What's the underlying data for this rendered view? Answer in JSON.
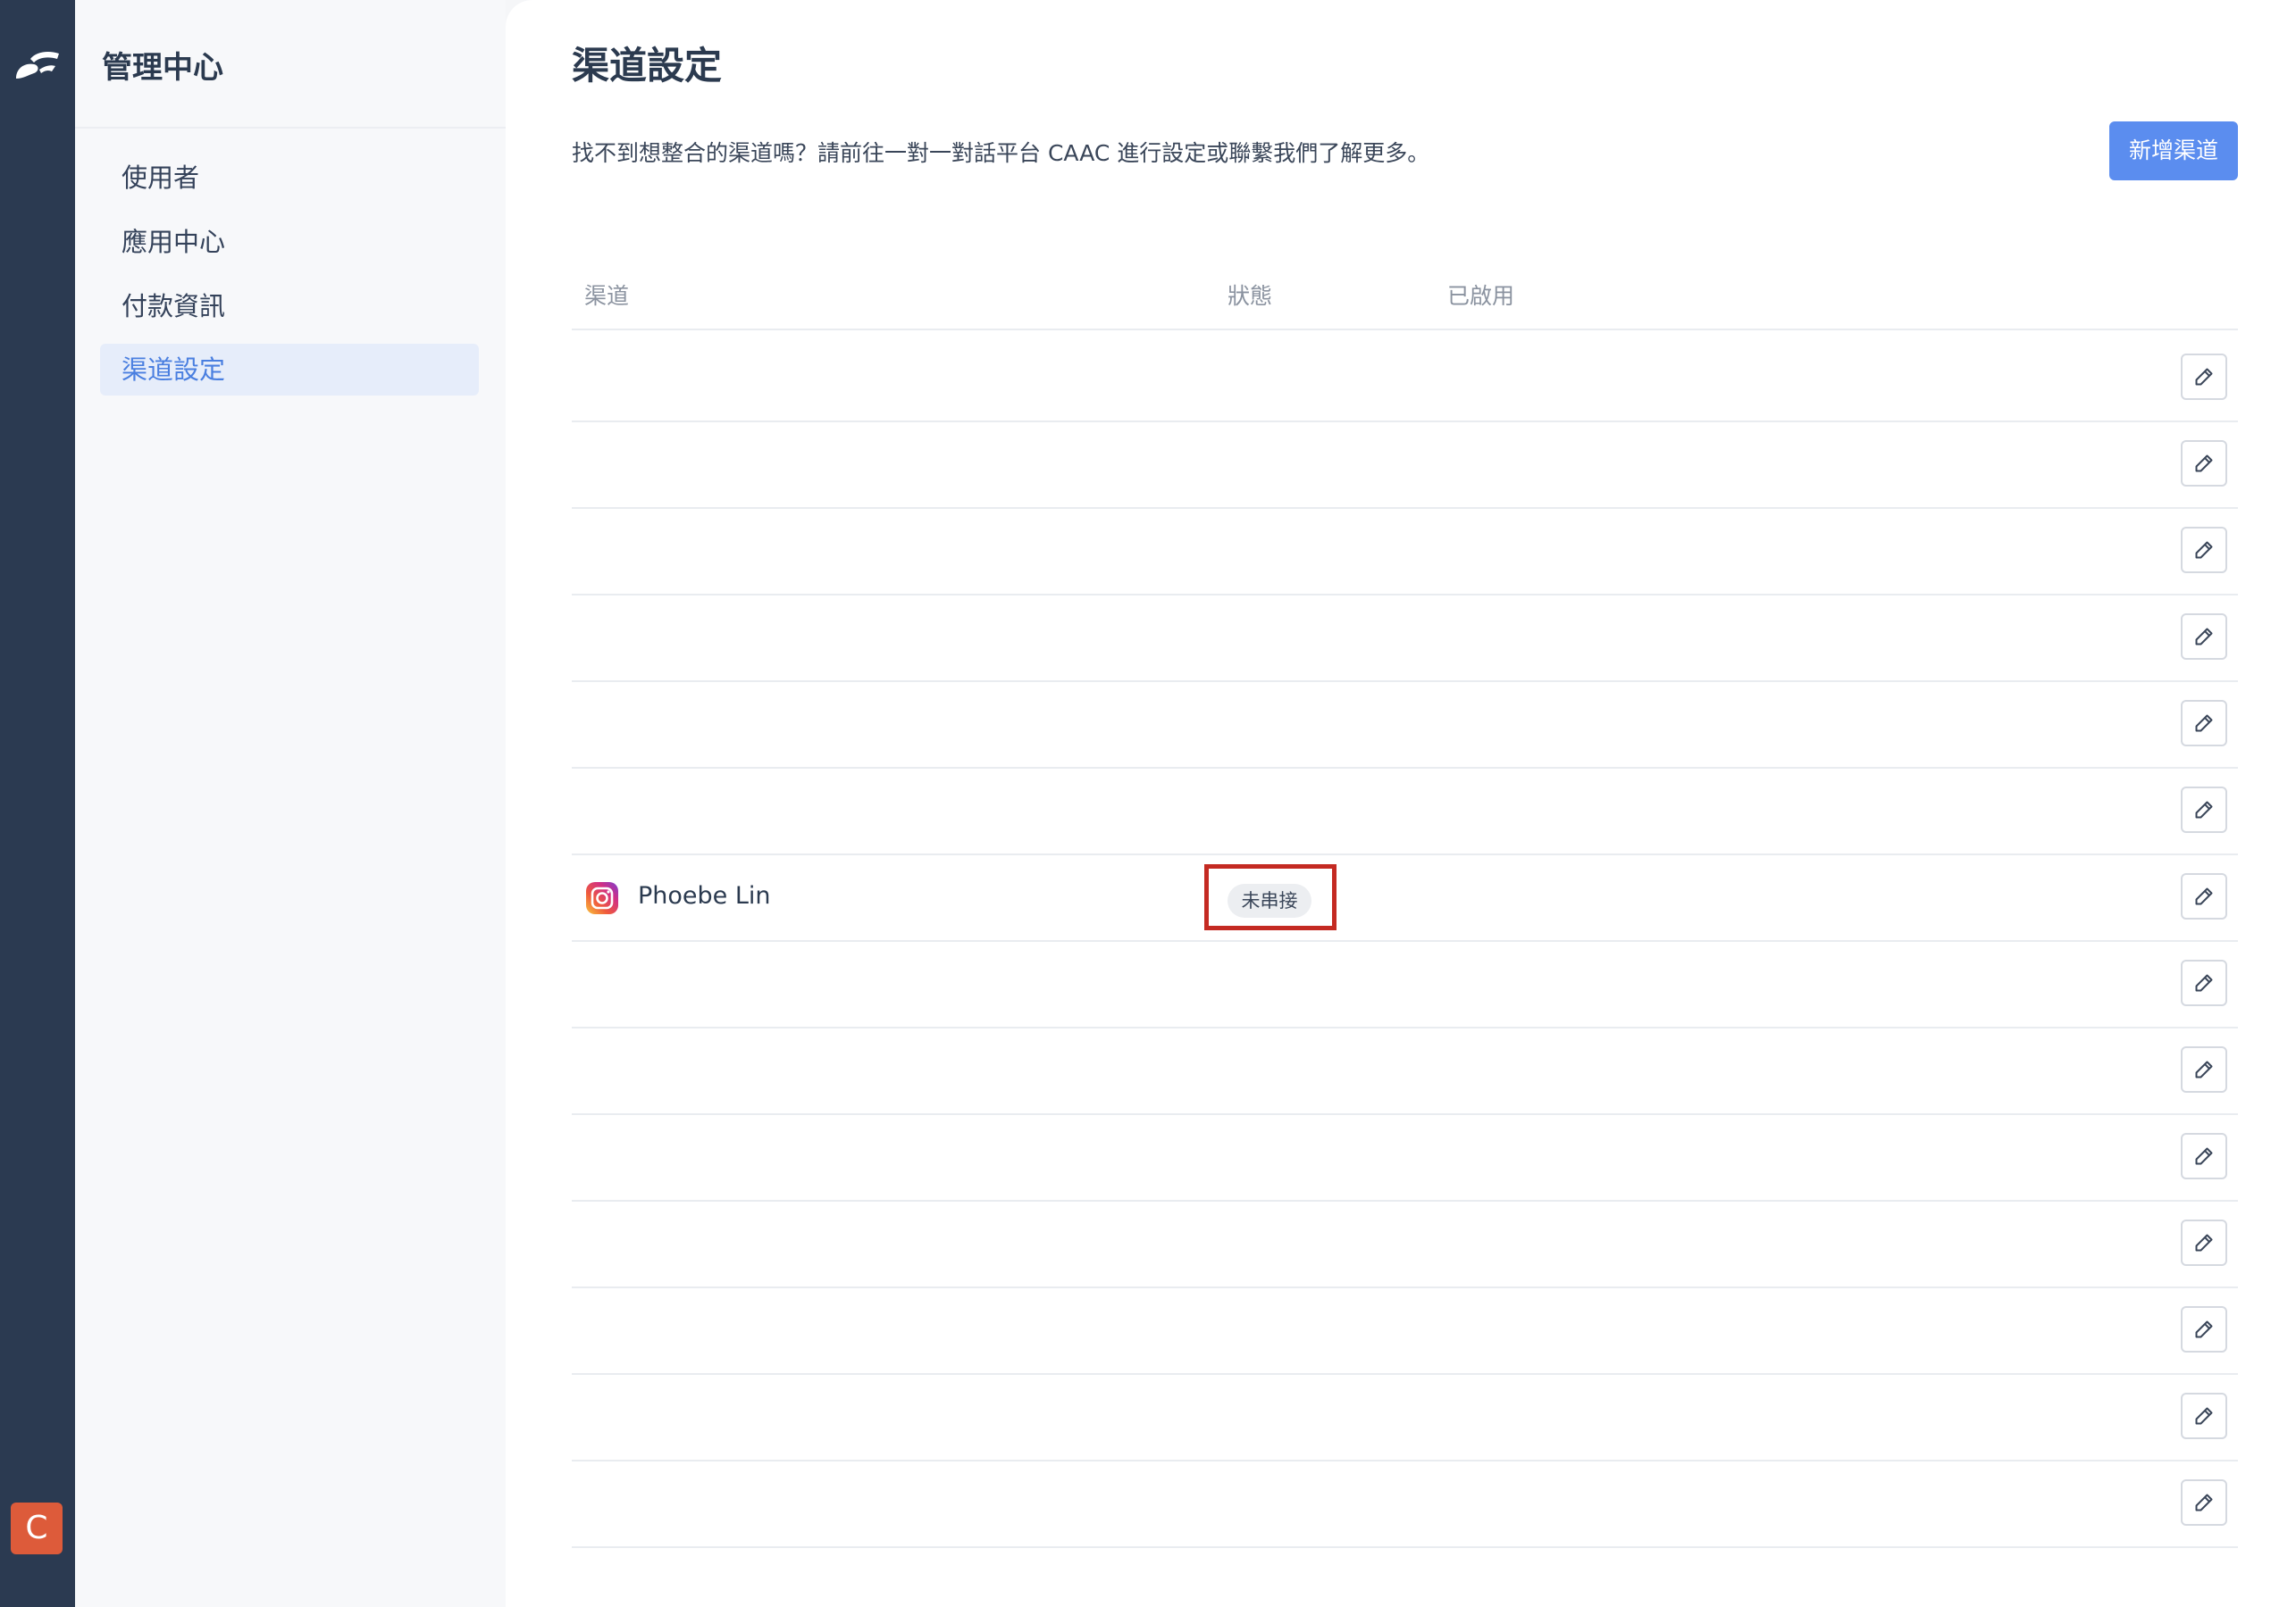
{
  "rail": {
    "logo_icon": "brand-logo-icon",
    "avatar_letter": "C",
    "avatar_color": "#dd5b3a"
  },
  "sidebar": {
    "title": "管理中心",
    "items": [
      {
        "label": "使用者",
        "active": false
      },
      {
        "label": "應用中心",
        "active": false
      },
      {
        "label": "付款資訊",
        "active": false
      },
      {
        "label": "渠道設定",
        "active": true
      }
    ]
  },
  "main": {
    "title": "渠道設定",
    "description": "找不到想整合的渠道嗎？請前往一對一對話平台 CAAC 進行設定或聯繫我們了解更多。",
    "add_button_label": "新增渠道",
    "accent_color": "#5b8def"
  },
  "table": {
    "columns": {
      "channel": "渠道",
      "status": "狀態",
      "enabled": "已啟用"
    },
    "rows": [
      {
        "channel_name": "",
        "status": ""
      },
      {
        "channel_name": "",
        "status": ""
      },
      {
        "channel_name": "",
        "status": ""
      },
      {
        "channel_name": "",
        "status": ""
      },
      {
        "channel_name": "",
        "status": ""
      },
      {
        "channel_name": "",
        "status": ""
      },
      {
        "channel_name": "Phoebe Lin",
        "channel_icon": "instagram-icon",
        "status": "未串接"
      },
      {
        "channel_name": "",
        "status": ""
      },
      {
        "channel_name": "",
        "status": ""
      },
      {
        "channel_name": "",
        "status": ""
      },
      {
        "channel_name": "",
        "status": ""
      },
      {
        "channel_name": "",
        "status": ""
      },
      {
        "channel_name": "",
        "status": ""
      },
      {
        "channel_name": "",
        "status": ""
      }
    ],
    "edit_icon": "pencil-icon",
    "highlight_color": "#c42a22"
  }
}
